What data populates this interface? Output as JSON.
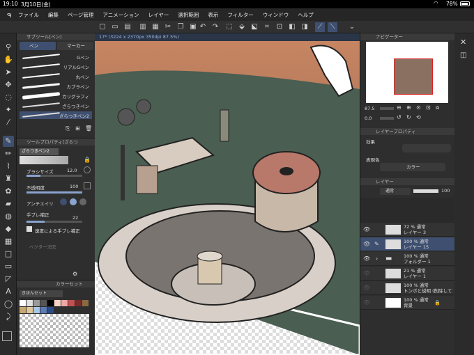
{
  "status": {
    "time": "19:10",
    "date": "3月10日(金)",
    "battery": "78%",
    "wifi_icon": "wifi-icon"
  },
  "menu": [
    "ファイル",
    "編集",
    "ページ管理",
    "アニメーション",
    "レイヤー",
    "選択範囲",
    "表示",
    "フィルター",
    "ウィンドウ",
    "ヘルプ"
  ],
  "doc_tab": "17* (3224 x 2370px 350dpi 87.5%)",
  "subtool": {
    "header": "サブツール[ペン]",
    "tabs": [
      "ペン",
      "マーカー"
    ],
    "brushes": [
      "Gペン",
      "リアルGペン",
      "丸ペン",
      "カブラペン",
      "カリグラフィ",
      "ざらつきペン",
      "ざらつきペン2"
    ]
  },
  "toolprop": {
    "header": "ツールプロパティ[ざらつ",
    "brush_name": "ざらつきペン2",
    "brush_size_label": "ブラシサイズ",
    "brush_size": "12.0",
    "opacity_label": "不透明度",
    "opacity": "100",
    "antialias_label": "アンチエイリ",
    "stabilize_label": "手ブレ補正",
    "stabilize": "22",
    "speed_label": "速度による手ブレ補正",
    "vector_label": "ベクター消去"
  },
  "colorset": {
    "header": "カラーセット",
    "set_name": "きほんセット",
    "colors": [
      "#ffffff",
      "#e0e0e0",
      "#9a9a9a",
      "#555555",
      "#000000",
      "#f3d3c3",
      "#f0a6a6",
      "#c65050",
      "#7a2a2a",
      "#8a6a40",
      "#c8a870",
      "#e0c898",
      "#a8c8e8",
      "#5a7ab8",
      "#2a4a88"
    ]
  },
  "navigator": {
    "header": "ナビゲーター",
    "zoom": "87.5",
    "rotate": "0.0"
  },
  "layerprop": {
    "header": "レイヤープロパティ",
    "effect_label": "効果",
    "expr_label": "表現色",
    "expr_value": "カラー"
  },
  "layers": {
    "header": "レイヤー",
    "blend": "通常",
    "opacity": "100",
    "items": [
      {
        "pct": "72 %",
        "mode": "通常",
        "name": "レイヤー 3"
      },
      {
        "pct": "100 %",
        "mode": "通常",
        "name": "レイヤー 15"
      },
      {
        "pct": "100 %",
        "mode": "通常",
        "name": "フォルダー 1"
      },
      {
        "pct": "21 %",
        "mode": "通常",
        "name": "レイヤー 1"
      },
      {
        "pct": "100 %",
        "mode": "通常",
        "name": "トンボと説明 (削除して"
      },
      {
        "pct": "100 %",
        "mode": "通常",
        "name": "背景"
      }
    ]
  }
}
